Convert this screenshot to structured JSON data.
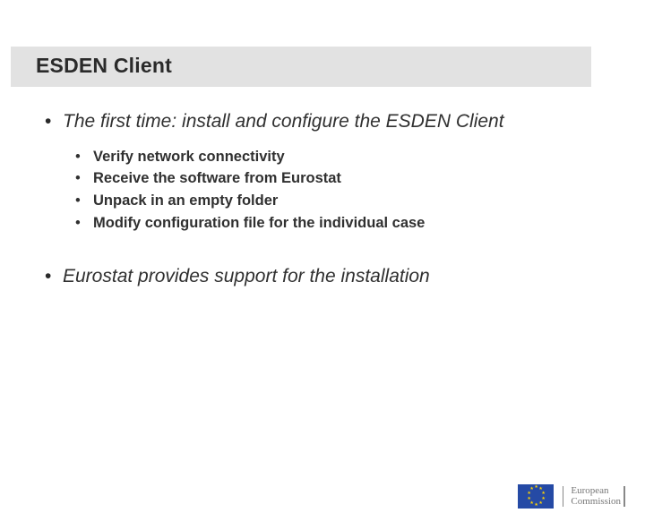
{
  "title": "ESDEN Client",
  "points": [
    {
      "text": "The first time: install and configure the ESDEN Client",
      "sub": [
        "Verify network connectivity",
        "Receive the software from Eurostat",
        "Unpack in an empty folder",
        "Modify configuration file for the individual case"
      ]
    },
    {
      "text": "Eurostat provides support for the installation"
    }
  ],
  "footer": {
    "line1": "European",
    "line2": "Commission"
  }
}
